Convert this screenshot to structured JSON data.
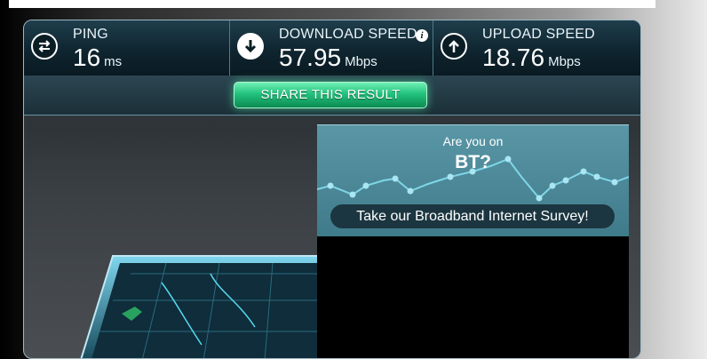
{
  "stats": {
    "ping": {
      "label": "PING",
      "value": "16",
      "unit": "ms",
      "icon": "transfer-arrows-icon"
    },
    "download": {
      "label": "DOWNLOAD SPEED",
      "value": "57.95",
      "unit": "Mbps",
      "icon": "arrow-down-icon"
    },
    "upload": {
      "label": "UPLOAD SPEED",
      "value": "18.76",
      "unit": "Mbps",
      "icon": "arrow-up-icon"
    }
  },
  "share": {
    "label": "SHARE THIS RESULT"
  },
  "survey": {
    "line1": "Are you on",
    "line2": "BT?",
    "button": "Take our Broadband Internet Survey!"
  },
  "colors": {
    "accent": "#22c27d",
    "panel": "#0f2530"
  }
}
